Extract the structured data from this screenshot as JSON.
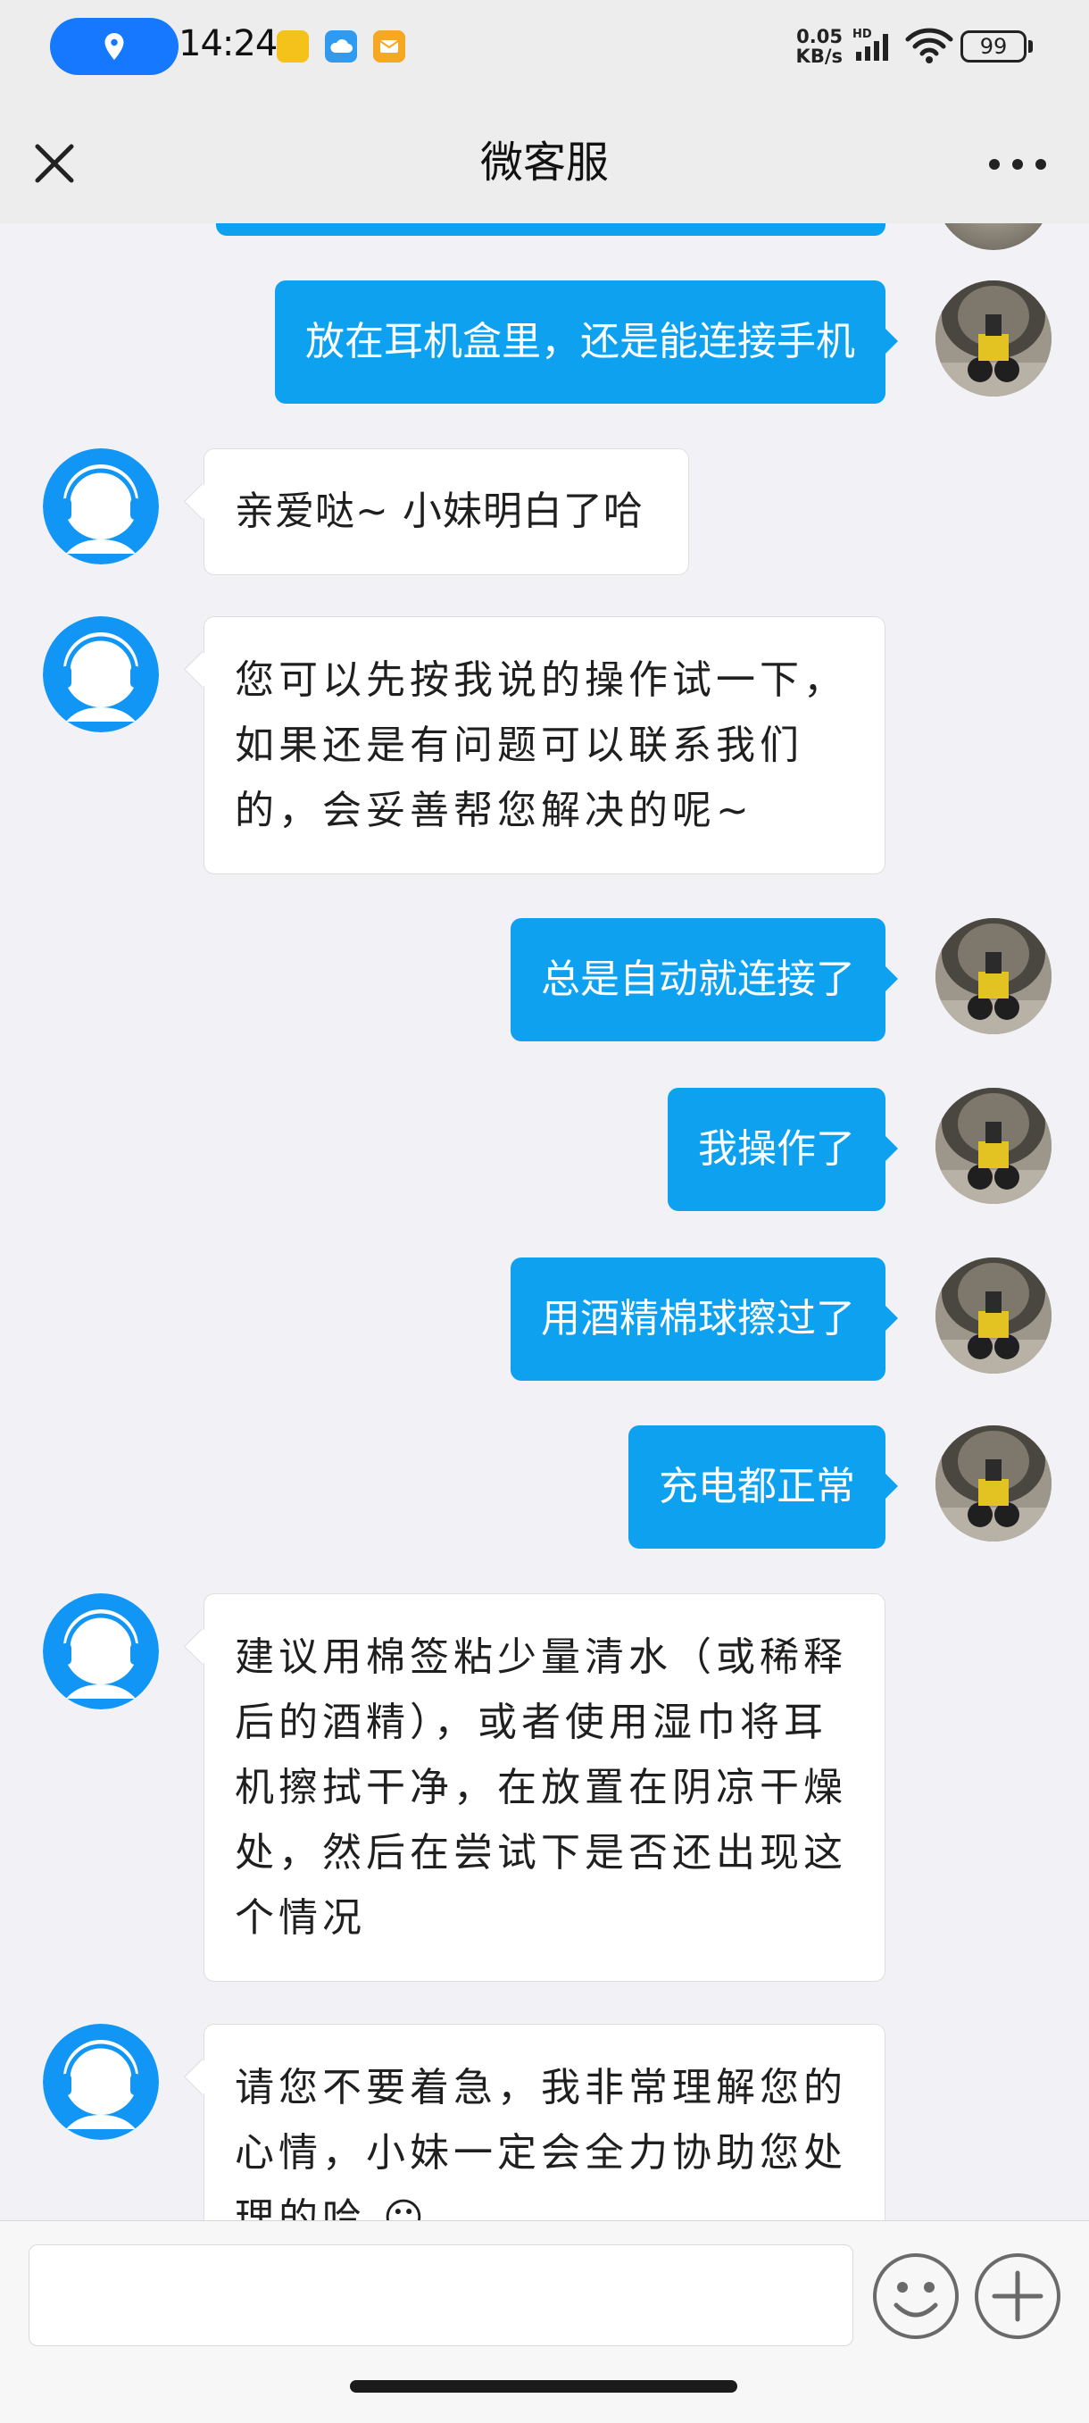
{
  "status_bar": {
    "time": "14:24",
    "net_speed_value": "0.05",
    "net_speed_unit": "KB/s",
    "net_type": "HD",
    "battery": "99"
  },
  "header": {
    "title": "微客服"
  },
  "messages": [
    {
      "from": "user",
      "text": "放在耳机盒里，还是能连接手机"
    },
    {
      "from": "agent",
      "lines": [
        "亲爱哒~ 小妹明白了哈"
      ]
    },
    {
      "from": "agent",
      "lines": [
        "您可以先按我说的操作试一下，",
        "如果还是有问题可以联系我们",
        "的，会妥善帮您解决的呢~"
      ]
    },
    {
      "from": "user",
      "text": "总是自动就连接了"
    },
    {
      "from": "user",
      "text": "我操作了"
    },
    {
      "from": "user",
      "text": "用酒精棉球擦过了"
    },
    {
      "from": "user",
      "text": "充电都正常"
    },
    {
      "from": "agent",
      "lines": [
        "建议用棉签粘少量清水（或稀释",
        "后的酒精），或者使用湿巾将耳",
        "机擦拭干净，在放置在阴凉干燥",
        "处，然后在尝试下是否还出现这",
        "个情况"
      ]
    },
    {
      "from": "agent",
      "lines": [
        "请您不要着急，我非常理解您的",
        "心情，小妹一定会全力协助您处",
        "理的哈 😶"
      ]
    }
  ],
  "input": {
    "value": "",
    "placeholder": ""
  },
  "icons": {
    "location": "location-pin-icon",
    "close": "close-icon",
    "more": "more-dots-icon",
    "emoji": "emoji-icon",
    "plus": "plus-icon"
  },
  "colors": {
    "outgoing_bubble": "#0ea1f0",
    "incoming_bubble": "#ffffff",
    "chat_background": "#f2f2f6",
    "location_pill": "#1677ff"
  }
}
